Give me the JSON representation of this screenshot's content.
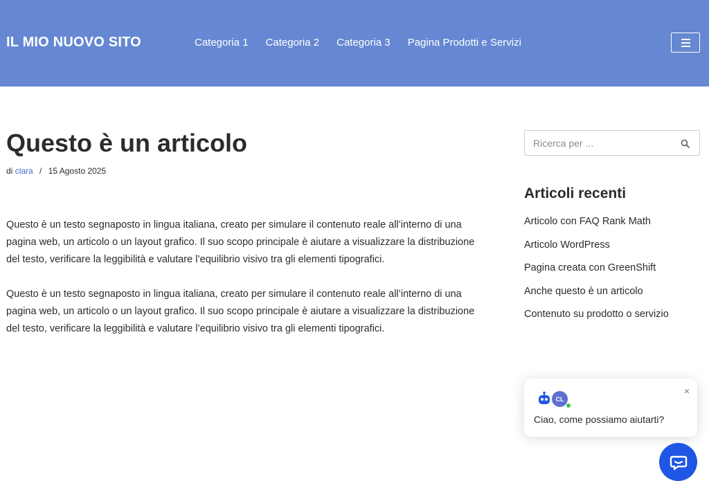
{
  "header": {
    "site_title": "IL MIO NUOVO SITO",
    "nav": [
      "Categoria 1",
      "Categoria 2",
      "Categoria 3",
      "Pagina Prodotti e Servizi"
    ],
    "menu_icon": "hamburger-icon"
  },
  "post": {
    "title": "Questo è un articolo",
    "meta_prefix": "di",
    "author": "clara",
    "separator": "/",
    "date": "15 Agosto 2025",
    "paragraphs": [
      "Questo è un testo segnaposto in lingua italiana, creato per simulare il contenuto reale all’interno di una pagina web, un articolo o un layout grafico. Il suo scopo principale è aiutare a visualizzare la distribuzione del testo, verificare la leggibilità e valutare l’equilibrio visivo tra gli elementi tipografici.",
      "Questo è un testo segnaposto in lingua italiana, creato per simulare il contenuto reale all’interno di una pagina web, un articolo o un layout grafico. Il suo scopo principale è aiutare a visualizzare la distribuzione del testo, verificare la leggibilità e valutare l’equilibrio visivo tra gli elementi tipografici."
    ]
  },
  "sidebar": {
    "search_placeholder": "Ricerca per ...",
    "search_icon": "search-icon",
    "recent_title": "Articoli recenti",
    "recent_posts": [
      "Articolo con FAQ Rank Math",
      "Articolo WordPress",
      "Pagina creata con GreenShift",
      "Anche questo è un articolo",
      "Contenuto su prodotto o servizio"
    ]
  },
  "chat": {
    "close": "×",
    "avatar_initials": "CL",
    "message": "Ciao, come possiamo aiutarti?",
    "launcher_icon": "chat-icon"
  },
  "colors": {
    "header_bg": "#6688d2",
    "link": "#3b6bc7",
    "chat_button": "#1f56e3"
  }
}
